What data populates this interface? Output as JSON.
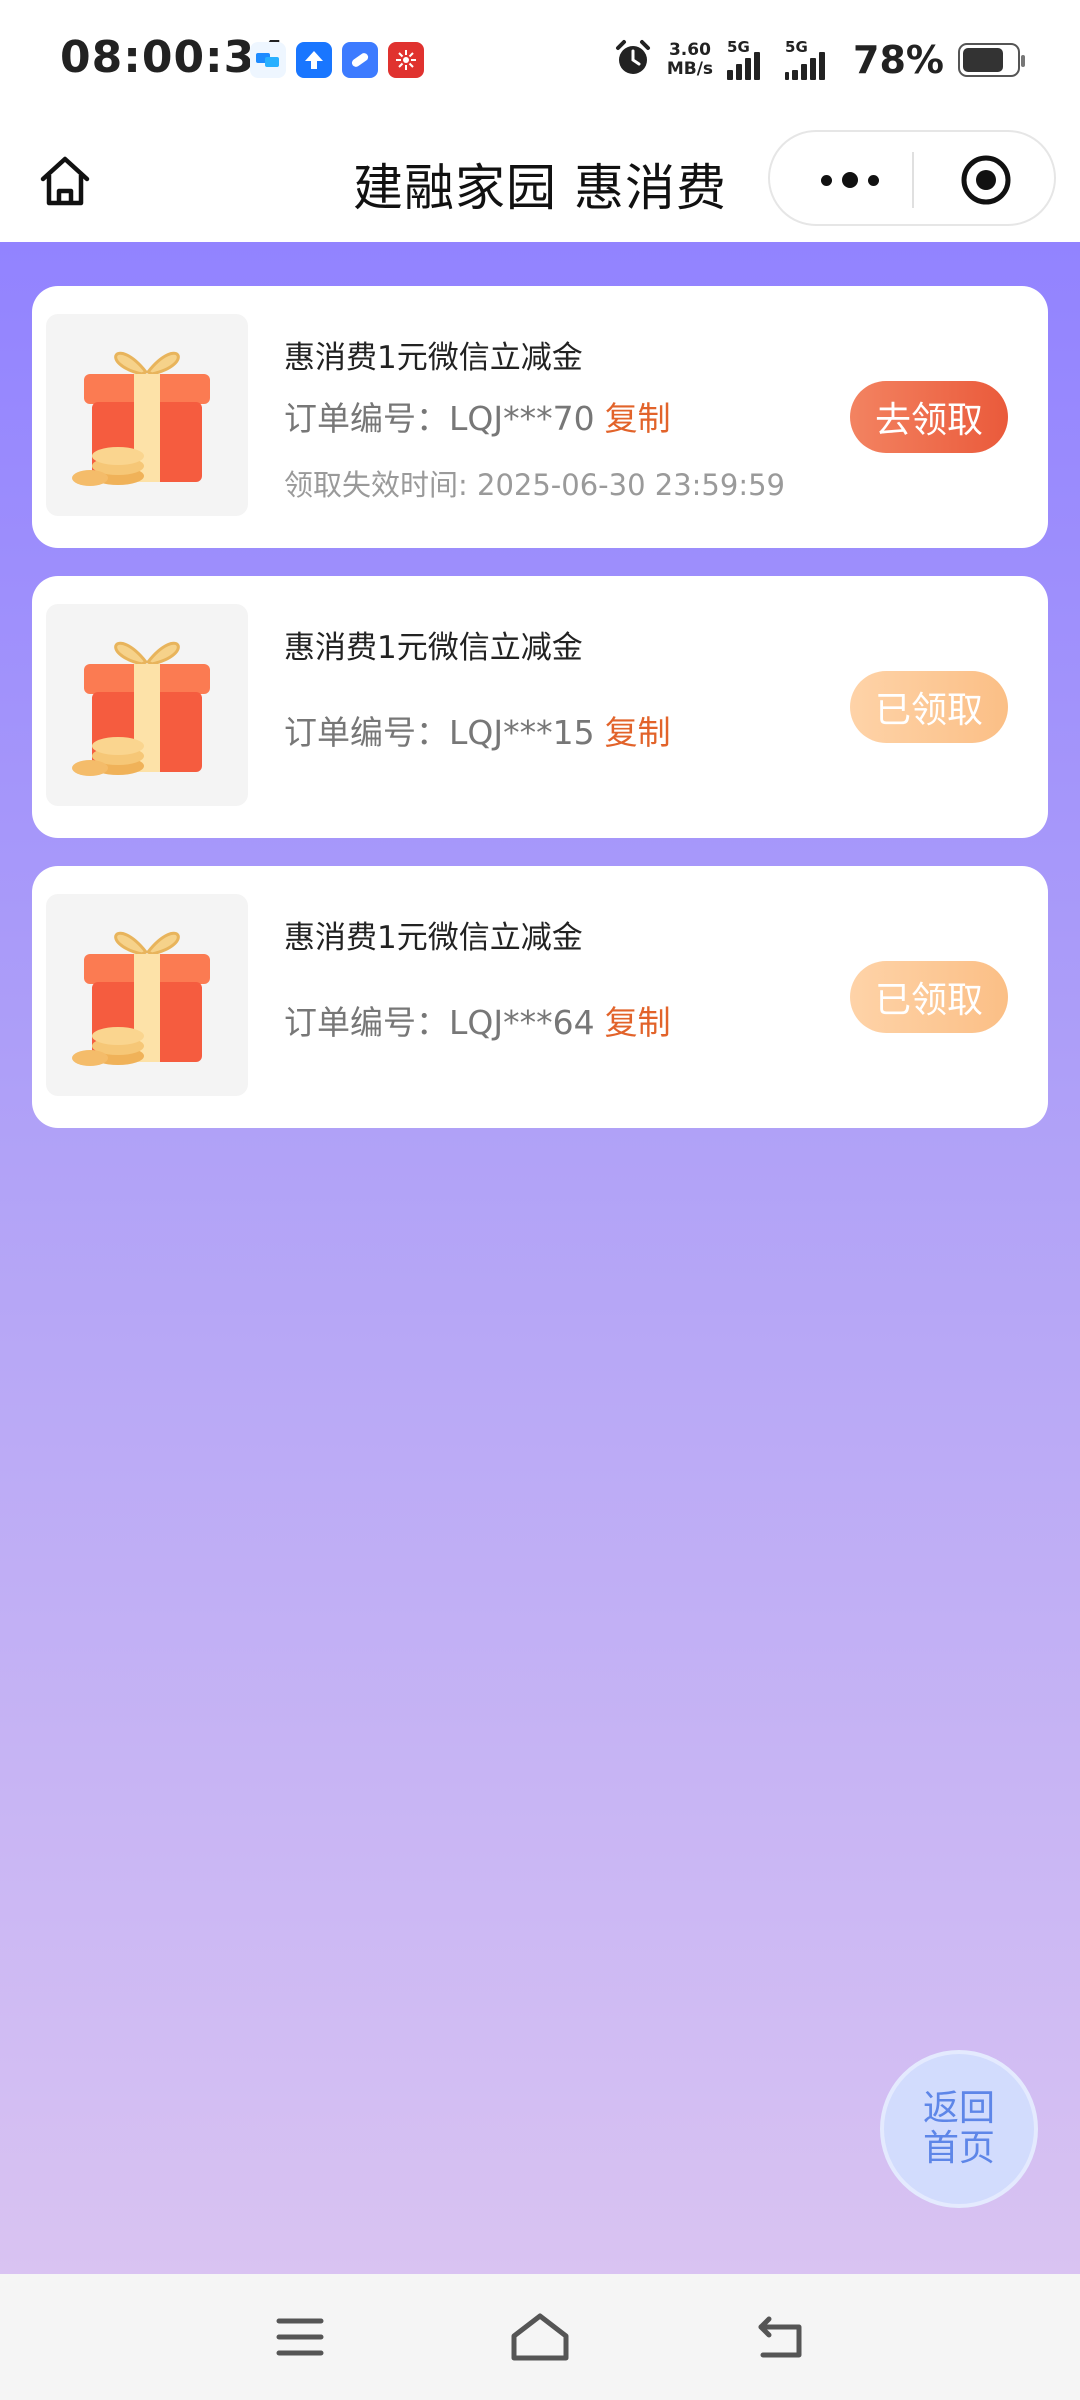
{
  "status_bar": {
    "time": "08:00:34",
    "net_speed_value": "3.60",
    "net_speed_unit": "MB/s",
    "signal1_label": "5G",
    "signal2_label": "5G",
    "battery": "78%",
    "battery_level": 0.78
  },
  "header": {
    "title": "建融家园 惠消费"
  },
  "coupons": [
    {
      "title": "惠消费1元微信立减金",
      "order_label": "订单编号：",
      "order_no": "LQJ***70",
      "copy_label": "复制",
      "expire_text": "领取失效时间: 2025-06-30 23:59:59",
      "action": "去领取",
      "status": "active"
    },
    {
      "title": "惠消费1元微信立减金",
      "order_label": "订单编号：",
      "order_no": "LQJ***15",
      "copy_label": "复制",
      "action": "已领取",
      "status": "claimed"
    },
    {
      "title": "惠消费1元微信立减金",
      "order_label": "订单编号：",
      "order_no": "LQJ***64",
      "copy_label": "复制",
      "action": "已领取",
      "status": "claimed"
    }
  ],
  "floating": {
    "back_home_line1": "返回",
    "back_home_line2": "首页"
  },
  "colors": {
    "gradient_top": "#9283ff",
    "gradient_bottom": "#d9c3f2",
    "copy_link": "#e2632a",
    "active_button": "#ea5a3b",
    "claimed_button": "#fbbf86",
    "back_home_text": "#5e86e8"
  },
  "icons": {
    "header_home": "home-icon",
    "more": "more-dots-icon",
    "close_miniprogram": "target-icon",
    "coupon_image": "gift-box-icon",
    "nav_menu": "menu-icon",
    "nav_home": "home-icon",
    "nav_back": "back-icon"
  }
}
